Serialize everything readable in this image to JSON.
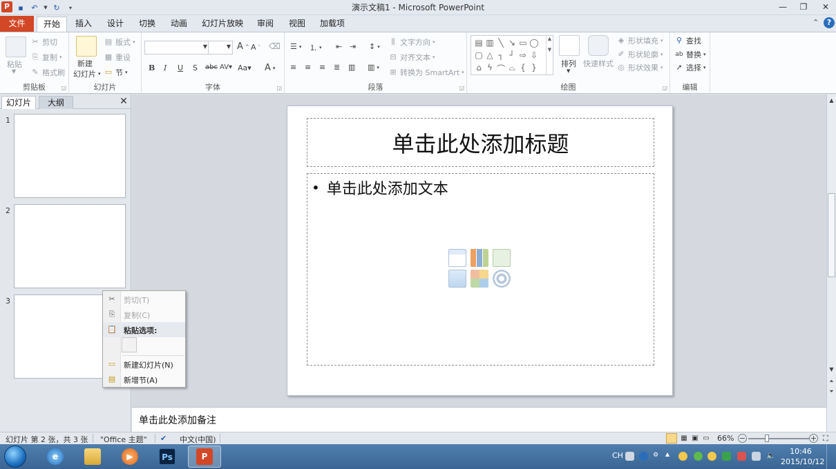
{
  "window": {
    "title": "演示文稿1 - Microsoft PowerPoint",
    "app_icon": "P"
  },
  "tabs": [
    {
      "label": "文件"
    },
    {
      "label": "开始"
    },
    {
      "label": "插入"
    },
    {
      "label": "设计"
    },
    {
      "label": "切换"
    },
    {
      "label": "动画"
    },
    {
      "label": "幻灯片放映"
    },
    {
      "label": "审阅"
    },
    {
      "label": "视图"
    },
    {
      "label": "加载项"
    }
  ],
  "ribbon": {
    "clipboard": {
      "label": "剪贴板",
      "paste": "粘贴",
      "cut": "剪切",
      "copy": "复制",
      "format_painter": "格式刷"
    },
    "slides": {
      "label": "幻灯片",
      "new_slide_1": "新建",
      "new_slide_2": "幻灯片",
      "layout": "版式",
      "reset": "重设",
      "section": "节"
    },
    "font": {
      "label": "字体"
    },
    "paragraph": {
      "label": "段落",
      "text_direction": "文字方向",
      "align_text": "对齐文本",
      "smartart": "转换为 SmartArt"
    },
    "drawing": {
      "label": "绘图",
      "arrange": "排列",
      "quick_styles": "快速样式",
      "shape_fill": "形状填充",
      "shape_outline": "形状轮廓",
      "shape_effects": "形状效果"
    },
    "editing": {
      "label": "编辑",
      "find": "查找",
      "replace": "替换",
      "select": "选择"
    }
  },
  "pane": {
    "tab_slides": "幻灯片",
    "tab_outline": "大纲",
    "thumbnails": [
      {
        "num": "1"
      },
      {
        "num": "2"
      },
      {
        "num": "3"
      }
    ]
  },
  "slide": {
    "title_placeholder": "单击此处添加标题",
    "body_placeholder": "单击此处添加文本",
    "bullet": "•"
  },
  "notes": {
    "placeholder": "单击此处添加备注"
  },
  "context_menu": {
    "cut": "剪切(T)",
    "copy": "复制(C)",
    "paste_options": "粘贴选项:",
    "new_slide": "新建幻灯片(N)",
    "new_section": "新增节(A)"
  },
  "status": {
    "slide_info": "幻灯片 第 2 张，共 3 张",
    "theme": "\"Office 主题\"",
    "language": "中文(中国)",
    "zoom": "66%"
  },
  "taskbar": {
    "lang": "CH",
    "time": "10:46",
    "date": "2015/10/12"
  },
  "colors": {
    "accent_file_tab": "#d24726",
    "ribbon_bg": "#fbfcfd",
    "taskbar": "#3a6594"
  }
}
